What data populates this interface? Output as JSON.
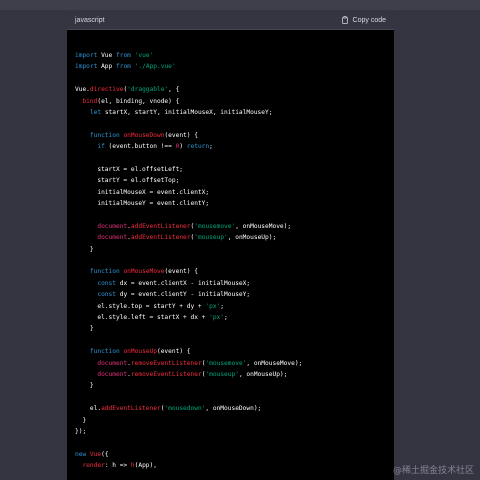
{
  "code_block": {
    "language": "javascript",
    "copy_label": "Copy code",
    "copy_icon": "clipboard-icon",
    "lines": [
      [
        [
          "kw",
          "import"
        ],
        [
          "t",
          " Vue "
        ],
        [
          "kw",
          "from"
        ],
        [
          "t",
          " "
        ],
        [
          "str",
          "'vue'"
        ]
      ],
      [
        [
          "kw",
          "import"
        ],
        [
          "t",
          " App "
        ],
        [
          "kw",
          "from"
        ],
        [
          "t",
          " "
        ],
        [
          "str",
          "'./App.vue'"
        ]
      ],
      [],
      [
        [
          "t",
          "Vue."
        ],
        [
          "fn",
          "directive"
        ],
        [
          "t",
          "("
        ],
        [
          "str",
          "'draggable'"
        ],
        [
          "t",
          ", {"
        ]
      ],
      [
        [
          "t",
          "  "
        ],
        [
          "fn",
          "bind"
        ],
        [
          "t",
          "(el, binding, vnode) {"
        ]
      ],
      [
        [
          "t",
          "    "
        ],
        [
          "kw",
          "let"
        ],
        [
          "t",
          " startX, startY, initialMouseX, initialMouseY;"
        ]
      ],
      [],
      [
        [
          "t",
          "    "
        ],
        [
          "kw",
          "function"
        ],
        [
          "t",
          " "
        ],
        [
          "fn",
          "onMouseDown"
        ],
        [
          "t",
          "(event) {"
        ]
      ],
      [
        [
          "t",
          "      "
        ],
        [
          "kw",
          "if"
        ],
        [
          "t",
          " (event.button !== "
        ],
        [
          "num",
          "0"
        ],
        [
          "t",
          ") "
        ],
        [
          "kw",
          "return"
        ],
        [
          "t",
          ";"
        ]
      ],
      [],
      [
        [
          "t",
          "      startX = el.offsetLeft;"
        ]
      ],
      [
        [
          "t",
          "      startY = el.offsetTop;"
        ]
      ],
      [
        [
          "t",
          "      initialMouseX = event.clientX;"
        ]
      ],
      [
        [
          "t",
          "      initialMouseY = event.clientY;"
        ]
      ],
      [],
      [
        [
          "t",
          "      "
        ],
        [
          "var",
          "document"
        ],
        [
          "t",
          "."
        ],
        [
          "fn",
          "addEventListener"
        ],
        [
          "t",
          "("
        ],
        [
          "str",
          "'mousemove'"
        ],
        [
          "t",
          ", onMouseMove);"
        ]
      ],
      [
        [
          "t",
          "      "
        ],
        [
          "var",
          "document"
        ],
        [
          "t",
          "."
        ],
        [
          "fn",
          "addEventListener"
        ],
        [
          "t",
          "("
        ],
        [
          "str",
          "'mouseup'"
        ],
        [
          "t",
          ", onMouseUp);"
        ]
      ],
      [
        [
          "t",
          "    }"
        ]
      ],
      [],
      [
        [
          "t",
          "    "
        ],
        [
          "kw",
          "function"
        ],
        [
          "t",
          " "
        ],
        [
          "fn",
          "onMouseMove"
        ],
        [
          "t",
          "(event) {"
        ]
      ],
      [
        [
          "t",
          "      "
        ],
        [
          "kw",
          "const"
        ],
        [
          "t",
          " dx = event.clientX - initialMouseX;"
        ]
      ],
      [
        [
          "t",
          "      "
        ],
        [
          "kw",
          "const"
        ],
        [
          "t",
          " dy = event.clientY - initialMouseY;"
        ]
      ],
      [
        [
          "t",
          "      el.style.top = startY + dy + "
        ],
        [
          "str",
          "'px'"
        ],
        [
          "t",
          ";"
        ]
      ],
      [
        [
          "t",
          "      el.style.left = startX + dx + "
        ],
        [
          "str",
          "'px'"
        ],
        [
          "t",
          ";"
        ]
      ],
      [
        [
          "t",
          "    }"
        ]
      ],
      [],
      [
        [
          "t",
          "    "
        ],
        [
          "kw",
          "function"
        ],
        [
          "t",
          " "
        ],
        [
          "fn",
          "onMouseUp"
        ],
        [
          "t",
          "(event) {"
        ]
      ],
      [
        [
          "t",
          "      "
        ],
        [
          "var",
          "document"
        ],
        [
          "t",
          "."
        ],
        [
          "fn",
          "removeEventListener"
        ],
        [
          "t",
          "("
        ],
        [
          "str",
          "'mousemove'"
        ],
        [
          "t",
          ", onMouseMove);"
        ]
      ],
      [
        [
          "t",
          "      "
        ],
        [
          "var",
          "document"
        ],
        [
          "t",
          "."
        ],
        [
          "fn",
          "removeEventListener"
        ],
        [
          "t",
          "("
        ],
        [
          "str",
          "'mouseup'"
        ],
        [
          "t",
          ", onMouseUp);"
        ]
      ],
      [
        [
          "t",
          "    }"
        ]
      ],
      [],
      [
        [
          "t",
          "    el."
        ],
        [
          "fn",
          "addEventListener"
        ],
        [
          "t",
          "("
        ],
        [
          "str",
          "'mousedown'"
        ],
        [
          "t",
          ", onMouseDown);"
        ]
      ],
      [
        [
          "t",
          "  }"
        ]
      ],
      [
        [
          "t",
          "});"
        ]
      ],
      [],
      [
        [
          "kw",
          "new"
        ],
        [
          "t",
          " "
        ],
        [
          "fn",
          "Vue"
        ],
        [
          "t",
          "({"
        ]
      ],
      [
        [
          "t",
          "  "
        ],
        [
          "fn",
          "render"
        ],
        [
          "t",
          ": h => "
        ],
        [
          "fn",
          "h"
        ],
        [
          "t",
          "(App),"
        ]
      ]
    ]
  },
  "watermark": "@稀土掘金技术社区",
  "colors": {
    "page_bg": "#343541",
    "code_bg": "#000000",
    "keyword": "#2e95d3",
    "string": "#00a67d",
    "function": "#f22c3d",
    "variable": "#df3079"
  }
}
